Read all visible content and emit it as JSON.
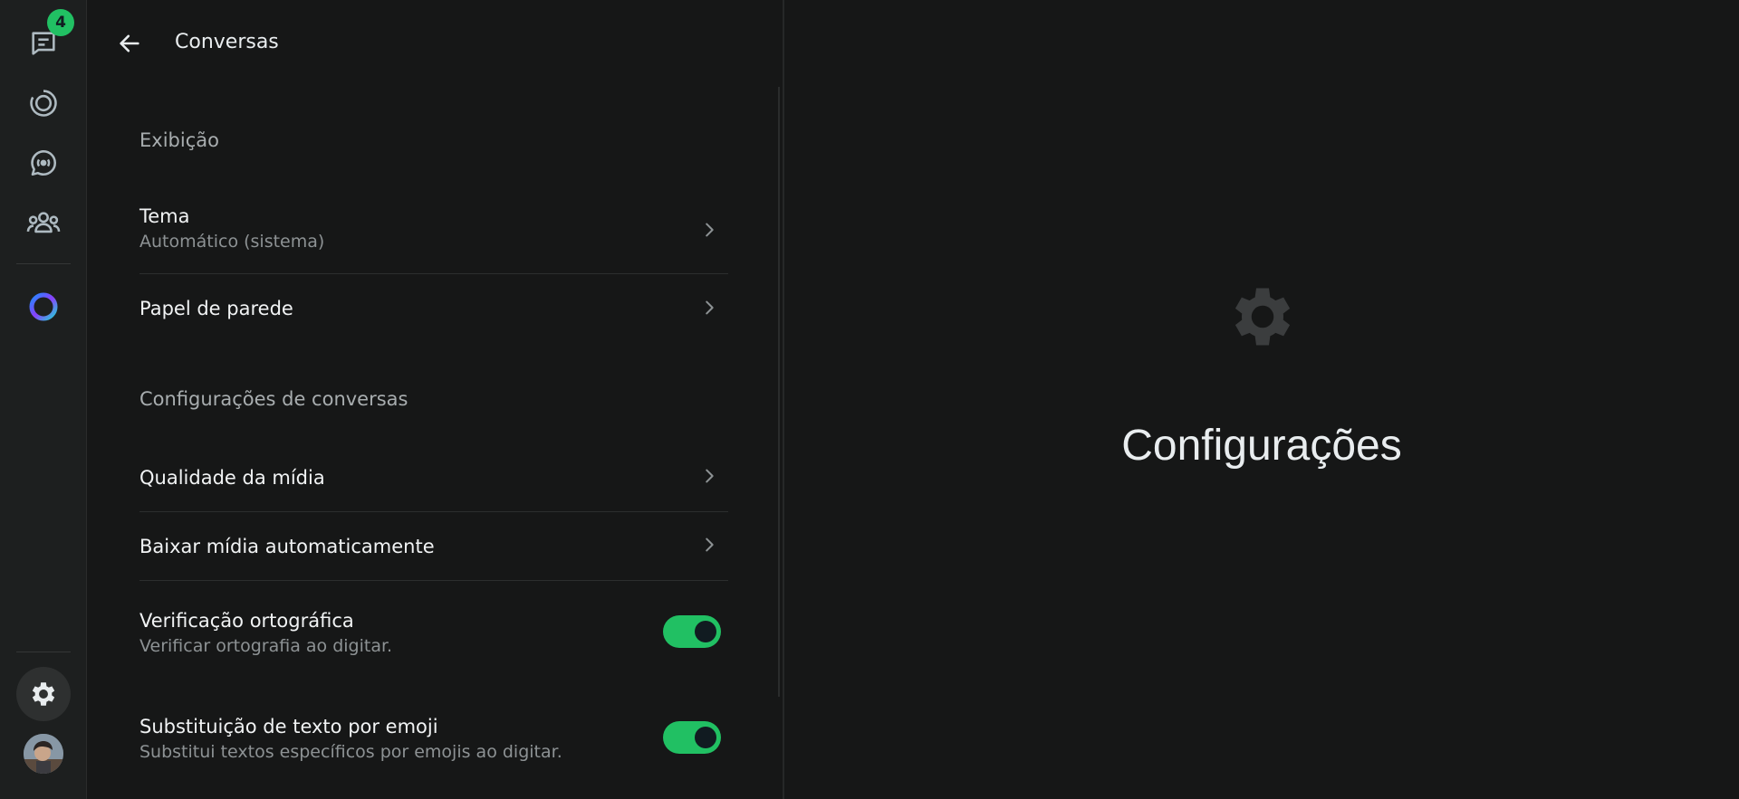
{
  "rail": {
    "chats_badge": "4",
    "items": [
      {
        "name": "chats",
        "icon": "chats-icon"
      },
      {
        "name": "status",
        "icon": "status-icon"
      },
      {
        "name": "channels",
        "icon": "channels-icon"
      },
      {
        "name": "communities",
        "icon": "communities-icon"
      },
      {
        "name": "meta-ai",
        "icon": "meta-ai-icon"
      },
      {
        "name": "settings",
        "icon": "gear-icon",
        "active": true
      },
      {
        "name": "profile",
        "icon": "avatar"
      }
    ],
    "accent": "#21c063"
  },
  "panel": {
    "title": "Conversas",
    "sections": [
      {
        "title": "Exibição",
        "rows": [
          {
            "label": "Tema",
            "sub": "Automático (sistema)",
            "control": "chevron"
          },
          {
            "label": "Papel de parede",
            "control": "chevron"
          }
        ]
      },
      {
        "title": "Configurações de conversas",
        "rows": [
          {
            "label": "Qualidade da mídia",
            "control": "chevron"
          },
          {
            "label": "Baixar mídia automaticamente",
            "control": "chevron"
          },
          {
            "label": "Verificação ortográfica",
            "sub": "Verificar ortografia ao digitar.",
            "control": "toggle",
            "on": true
          },
          {
            "label": "Substituição de texto por emoji",
            "sub": "Substitui textos específicos por emojis ao digitar.",
            "control": "toggle",
            "on": true
          }
        ]
      }
    ]
  },
  "main": {
    "title": "Configurações",
    "icon": "gear-icon"
  }
}
